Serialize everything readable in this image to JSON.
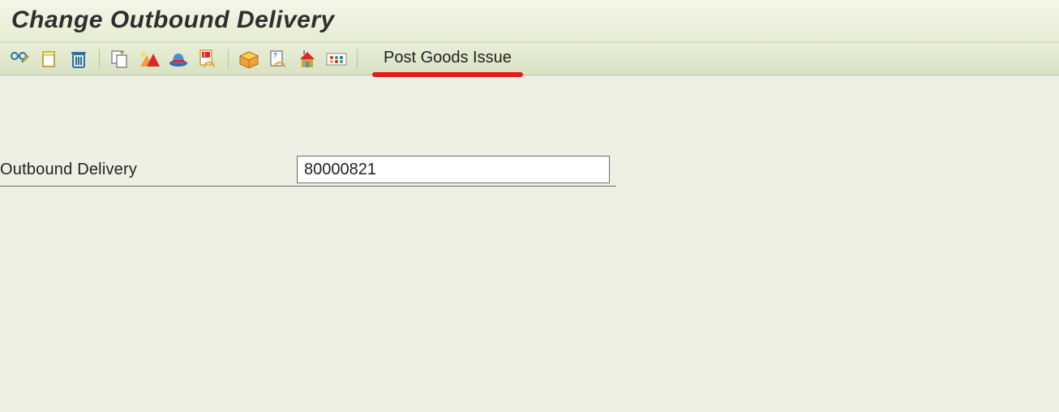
{
  "header": {
    "title": "Change Outbound Delivery"
  },
  "toolbar": {
    "icons": [
      "display-change-icon",
      "document-other-icon",
      "delete-icon",
      "copy-icon",
      "header-details-icon",
      "packing-icon",
      "incompletion-icon",
      "split-icon",
      "batch-split-icon",
      "services-icon",
      "overview-icon"
    ],
    "post_goods_issue_label": "Post Goods Issue"
  },
  "form": {
    "outbound_delivery_label": "Outbound Delivery",
    "outbound_delivery_value": "80000821"
  }
}
